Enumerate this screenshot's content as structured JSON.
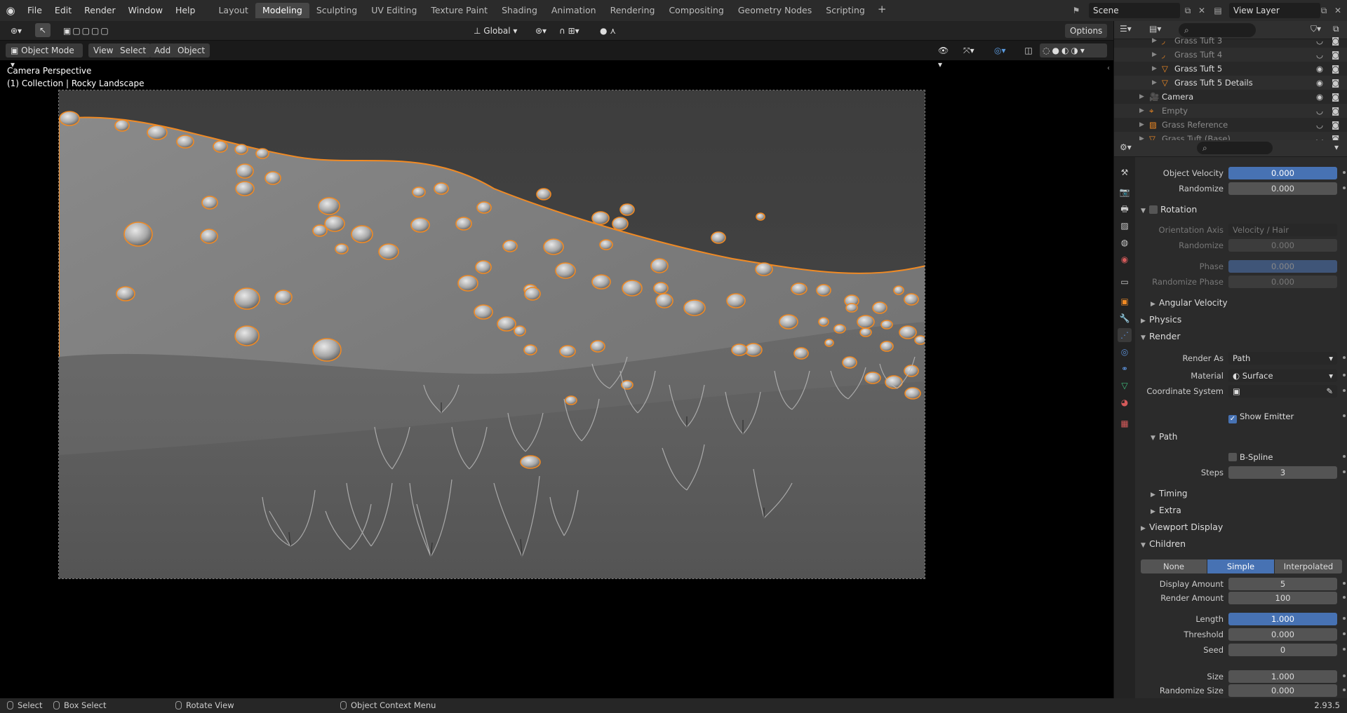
{
  "menu": [
    "File",
    "Edit",
    "Render",
    "Window",
    "Help"
  ],
  "workspaces": [
    {
      "label": "Layout",
      "active": false
    },
    {
      "label": "Modeling",
      "active": true
    },
    {
      "label": "Sculpting",
      "active": false
    },
    {
      "label": "UV Editing",
      "active": false
    },
    {
      "label": "Texture Paint",
      "active": false
    },
    {
      "label": "Shading",
      "active": false
    },
    {
      "label": "Animation",
      "active": false
    },
    {
      "label": "Rendering",
      "active": false
    },
    {
      "label": "Compositing",
      "active": false
    },
    {
      "label": "Geometry Nodes",
      "active": false
    },
    {
      "label": "Scripting",
      "active": false
    }
  ],
  "scene": {
    "name": "Scene",
    "view_layer": "View Layer"
  },
  "viewport": {
    "transform_orientation": "Global",
    "options_label": "Options",
    "mode": "Object Mode",
    "menus": [
      "View",
      "Select",
      "Add",
      "Object"
    ],
    "camera_text": "Camera Perspective",
    "collection_text": "(1) Collection | Rocky Landscape"
  },
  "outliner": {
    "rows": [
      {
        "name": "Grass Tuft 3",
        "dim": true
      },
      {
        "name": "Grass Tuft 4",
        "dim": true
      },
      {
        "name": "Grass Tuft 5",
        "dim": false
      },
      {
        "name": "Grass Tuft 5 Details",
        "dim": false
      },
      {
        "name": "Camera",
        "dim": false
      },
      {
        "name": "Empty",
        "dim": true
      },
      {
        "name": "Grass Reference",
        "dim": true
      },
      {
        "name": "Grass Tuft (Base)",
        "dim": true
      }
    ]
  },
  "props": {
    "object_velocity": {
      "label": "Object Velocity",
      "value": "0.000"
    },
    "randomize1": {
      "label": "Randomize",
      "value": "0.000"
    },
    "rotation": {
      "title": "Rotation",
      "orientation_axis_label": "Orientation Axis",
      "orientation_axis_value": "Velocity / Hair",
      "randomize_label": "Randomize",
      "randomize_value": "0.000",
      "phase_label": "Phase",
      "phase_value": "0.000",
      "randomize_phase_label": "Randomize Phase",
      "randomize_phase_value": "0.000",
      "angular_velocity": "Angular Velocity"
    },
    "physics": "Physics",
    "render": {
      "title": "Render",
      "render_as_label": "Render As",
      "render_as_value": "Path",
      "material_label": "Material",
      "material_value": "Surface",
      "coord_label": "Coordinate System",
      "show_emitter": "Show Emitter",
      "path_title": "Path",
      "bspline": "B-Spline",
      "steps_label": "Steps",
      "steps_value": "3",
      "timing": "Timing",
      "extra": "Extra"
    },
    "viewport_display": "Viewport Display",
    "children": {
      "title": "Children",
      "modes": [
        "None",
        "Simple",
        "Interpolated"
      ],
      "active_mode": "Simple",
      "display_amount_label": "Display Amount",
      "display_amount_value": "5",
      "render_amount_label": "Render Amount",
      "render_amount_value": "100",
      "length_label": "Length",
      "length_value": "1.000",
      "threshold_label": "Threshold",
      "threshold_value": "0.000",
      "seed_label": "Seed",
      "seed_value": "0",
      "size_label": "Size",
      "size_value": "1.000",
      "randomize_size_label": "Randomize Size",
      "randomize_size_value": "0.000"
    }
  },
  "status": {
    "select": "Select",
    "box_select": "Box Select",
    "rotate_view": "Rotate View",
    "context_menu": "Object Context Menu",
    "version": "2.93.5"
  },
  "colors": {
    "accent": "#4772b3",
    "selection": "#f08a24"
  }
}
